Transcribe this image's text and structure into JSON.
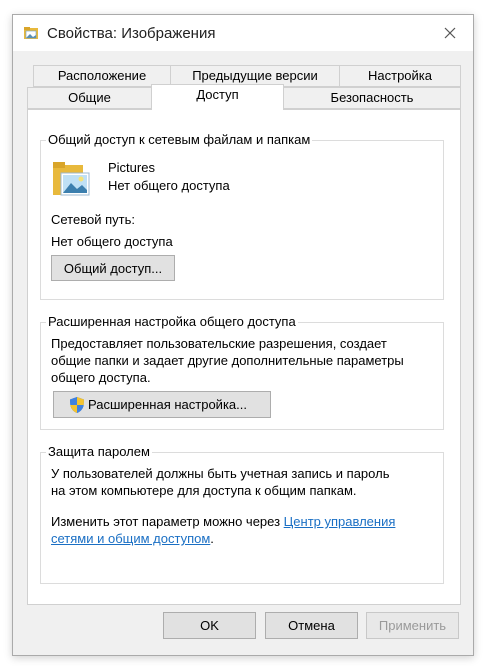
{
  "window": {
    "title": "Свойства: Изображения"
  },
  "tabs": {
    "row1": [
      "Расположение",
      "Предыдущие версии",
      "Настройка"
    ],
    "row2": [
      "Общие",
      "Доступ",
      "Безопасность"
    ],
    "active": "Доступ"
  },
  "network_sharing": {
    "group_title": "Общий доступ к сетевым файлам и папкам",
    "folder_name": "Pictures",
    "folder_status": "Нет общего доступа",
    "network_path_label": "Сетевой путь:",
    "network_path_value": "Нет общего доступа",
    "share_button": "Общий доступ..."
  },
  "advanced_sharing": {
    "group_title": "Расширенная настройка общего доступа",
    "description_line1": "Предоставляет пользовательские разрешения, создает",
    "description_line2": "общие папки и задает другие дополнительные параметры",
    "description_line3": "общего доступа.",
    "button": "Расширенная настройка..."
  },
  "password_protection": {
    "group_title": "Защита паролем",
    "text_line1": "У пользователей должны быть учетная запись и пароль",
    "text_line2": "на этом компьютере для доступа к общим папкам.",
    "change_prefix": "Изменить этот параметр можно через ",
    "link_part1": "Центр управления",
    "link_part2": "сетями и общим доступом",
    "suffix": "."
  },
  "footer": {
    "ok": "OK",
    "cancel": "Отмена",
    "apply": "Применить"
  },
  "icons": {
    "title": "folder-icon",
    "close": "close-icon",
    "folder_large": "folder-image-icon",
    "shield": "uac-shield-icon"
  }
}
